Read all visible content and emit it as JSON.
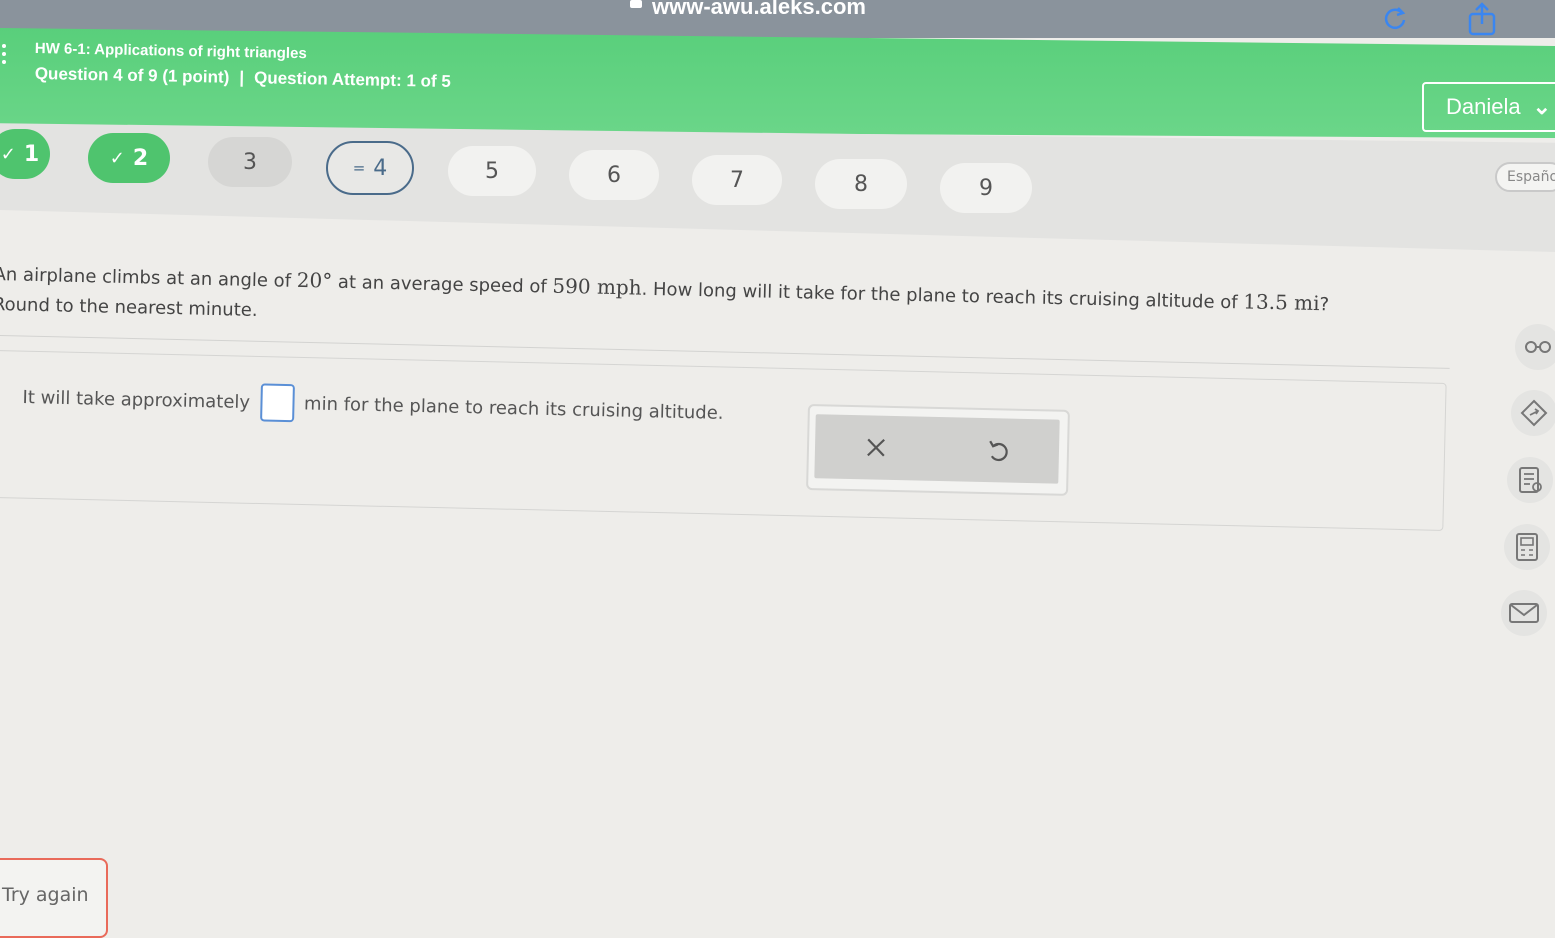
{
  "browser": {
    "url": "www-awu.aleks.com",
    "icons": [
      "reload-icon",
      "share-icon"
    ]
  },
  "header": {
    "assignment_title": "HW 6-1: Applications of right triangles",
    "question_info": "Question 4 of 9 (1 point)",
    "separator": "|",
    "attempt_info": "Question Attempt: 1 of 5",
    "user_name": "Daniela",
    "language_button": "Español",
    "accent_color": "#5ccf7d"
  },
  "question_nav": [
    {
      "label": "1",
      "status": "correct"
    },
    {
      "label": "2",
      "status": "correct"
    },
    {
      "label": "3",
      "status": "visited"
    },
    {
      "label": "4",
      "status": "current"
    },
    {
      "label": "5",
      "status": "unvisited"
    },
    {
      "label": "6",
      "status": "unvisited"
    },
    {
      "label": "7",
      "status": "unvisited"
    },
    {
      "label": "8",
      "status": "unvisited"
    },
    {
      "label": "9",
      "status": "unvisited"
    }
  ],
  "problem": {
    "text_1": "An airplane climbs at an angle of ",
    "angle": "20°",
    "text_2": " at an average speed of ",
    "speed": "590 mph",
    "text_3": ". How long will it take for the plane to reach its cruising altitude of ",
    "altitude": "13.5 mi",
    "text_4": "?",
    "instruction": "Round to the nearest minute."
  },
  "answer": {
    "prefix": "It will take approximately",
    "value": "",
    "suffix": "min for the plane to reach its cruising altitude."
  },
  "actions": {
    "clear_icon": "x-icon",
    "undo_icon": "undo-icon"
  },
  "side_tools": [
    "glasses-icon",
    "tag-icon",
    "notes-icon",
    "calculator-icon",
    "mail-icon"
  ],
  "footer": {
    "try_again": "Try again"
  }
}
